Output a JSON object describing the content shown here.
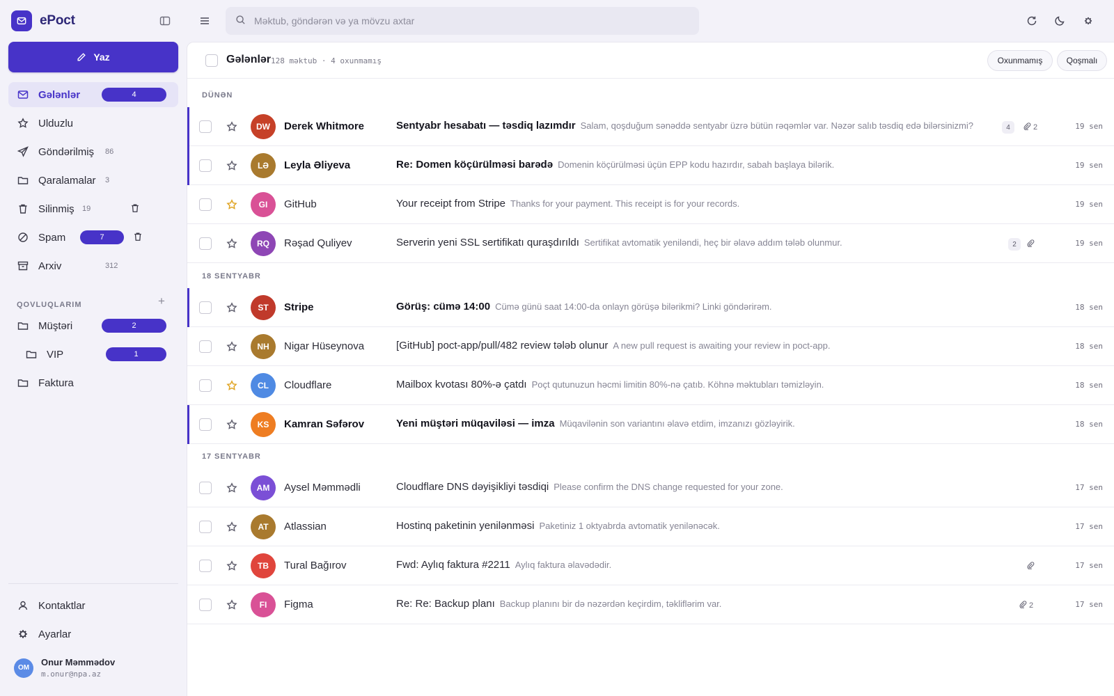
{
  "app": {
    "name": "ePoct",
    "compose_label": "Yaz"
  },
  "nav": [
    {
      "label": "Gələnlər",
      "badge": "4",
      "icon": "inbox-icon",
      "active": true
    },
    {
      "label": "Ulduzlu",
      "icon": "star-icon"
    },
    {
      "label": "Göndərilmiş",
      "count": "86",
      "icon": "send-icon"
    },
    {
      "label": "Qaralamalar",
      "count": "3",
      "icon": "draft-icon"
    },
    {
      "label": "Silinmiş",
      "count": "19",
      "icon": "trash-icon"
    },
    {
      "label": "Spam",
      "badge": "7",
      "icon": "spam-icon"
    },
    {
      "label": "Arxiv",
      "count": "312",
      "icon": "archive-icon"
    }
  ],
  "folders": {
    "heading": "QOVLUQLARIM",
    "items": [
      {
        "label": "Müştəri",
        "badge": "2"
      },
      {
        "label": "VIP",
        "badge": "1"
      },
      {
        "label": "Faktura"
      }
    ]
  },
  "footer_nav": [
    {
      "label": "Kontaktlar",
      "icon": "user-icon"
    },
    {
      "label": "Ayarlar",
      "icon": "gear-icon"
    }
  ],
  "user": {
    "initials": "OM",
    "name": "Onur Məmmədov",
    "email": "m.onur@npa.az"
  },
  "search": {
    "placeholder": "Məktub, göndərən və ya mövzu axtar"
  },
  "list_header": {
    "title": "Gələnlər",
    "meta": "128 məktub · 4 oxunmamış",
    "filters": [
      "Oxunmamış",
      "Qoşmalı"
    ]
  },
  "colors": {
    "accent": "#4733c8",
    "star_active": "#e0a526"
  },
  "groups": [
    {
      "label": "DÜNƏN",
      "messages": [
        {
          "initials": "DW",
          "avatar_color": "#c64128",
          "sender": "Derek Whitmore",
          "subject": "Sentyabr hesabatı — təsdiq lazımdır",
          "preview": "Salam, qoşduğum sənəddə sentyabr üzrə bütün rəqəmlər var. Nəzər salıb təsdiq edə bilərsinizmi?",
          "thread_count": "4",
          "attachments": "2",
          "date": "19 sen",
          "unread": true,
          "starred": false
        },
        {
          "initials": "LƏ",
          "avatar_color": "#a97a2e",
          "sender": "Leyla Əliyeva",
          "subject": "Re: Domen köçürülməsi barədə",
          "preview": "Domenin köçürülməsi üçün EPP kodu hazırdır, sabah başlaya bilərik.",
          "date": "19 sen",
          "unread": true,
          "starred": false
        },
        {
          "initials": "GI",
          "avatar_color": "#d95196",
          "sender": "GitHub",
          "subject": "Your receipt from Stripe",
          "preview": "Thanks for your payment. This receipt is for your records.",
          "date": "19 sen",
          "unread": false,
          "starred": true
        },
        {
          "initials": "RQ",
          "avatar_color": "#8e46b5",
          "sender": "Rəşad Quliyev",
          "subject": "Serverin yeni SSL sertifikatı quraşdırıldı",
          "preview": "Sertifikat avtomatik yeniləndi, heç bir əlavə addım tələb olunmur.",
          "thread_count": "2",
          "has_attachment": true,
          "date": "19 sen",
          "unread": false,
          "starred": false
        }
      ]
    },
    {
      "label": "18 SENTYABR",
      "messages": [
        {
          "initials": "ST",
          "avatar_color": "#c03a2b",
          "sender": "Stripe",
          "subject": "Görüş: cümə 14:00",
          "preview": "Cümə günü saat 14:00-da onlayn görüşə bilərikmi? Linki göndərirəm.",
          "date": "18 sen",
          "unread": true,
          "starred": false
        },
        {
          "initials": "NH",
          "avatar_color": "#a97a2e",
          "sender": "Nigar Hüseynova",
          "subject": "[GitHub] poct-app/pull/482 review tələb olunur",
          "preview": "A new pull request is awaiting your review in poct-app.",
          "date": "18 sen",
          "unread": false,
          "starred": false
        },
        {
          "initials": "CL",
          "avatar_color": "#4f8ae3",
          "sender": "Cloudflare",
          "subject": "Mailbox kvotası 80%-ə çatdı",
          "preview": "Poçt qutunuzun həcmi limitin 80%-nə çatıb. Köhnə məktubları təmizləyin.",
          "date": "18 sen",
          "unread": false,
          "starred": true
        },
        {
          "initials": "KS",
          "avatar_color": "#ee7d22",
          "sender": "Kamran Səfərov",
          "subject": "Yeni müştəri müqaviləsi — imza",
          "preview": "Müqavilənin son variantını əlavə etdim, imzanızı gözləyirik.",
          "date": "18 sen",
          "unread": true,
          "starred": false
        }
      ]
    },
    {
      "label": "17 SENTYABR",
      "messages": [
        {
          "initials": "AM",
          "avatar_color": "#7b4fd6",
          "sender": "Aysel Məmmədli",
          "subject": "Cloudflare DNS dəyişikliyi təsdiqi",
          "preview": "Please confirm the DNS change requested for your zone.",
          "date": "17 sen",
          "unread": false,
          "starred": false
        },
        {
          "initials": "AT",
          "avatar_color": "#a97a2e",
          "sender": "Atlassian",
          "subject": "Hostinq paketinin yenilənməsi",
          "preview": "Paketiniz 1 oktyabrda avtomatik yenilənəcək.",
          "date": "17 sen",
          "unread": false,
          "starred": false
        },
        {
          "initials": "TB",
          "avatar_color": "#e0453c",
          "sender": "Tural Bağırov",
          "subject": "Fwd: Aylıq faktura #2211",
          "preview": "Aylıq faktura əlavədədir.",
          "has_attachment": true,
          "date": "17 sen",
          "unread": false,
          "starred": false
        },
        {
          "initials": "FI",
          "avatar_color": "#d95196",
          "sender": "Figma",
          "subject": "Re: Re: Backup planı",
          "preview": "Backup planını bir də nəzərdən keçirdim, təkliflərim var.",
          "attachments": "2",
          "date": "17 sen",
          "unread": false,
          "starred": false
        }
      ]
    }
  ]
}
